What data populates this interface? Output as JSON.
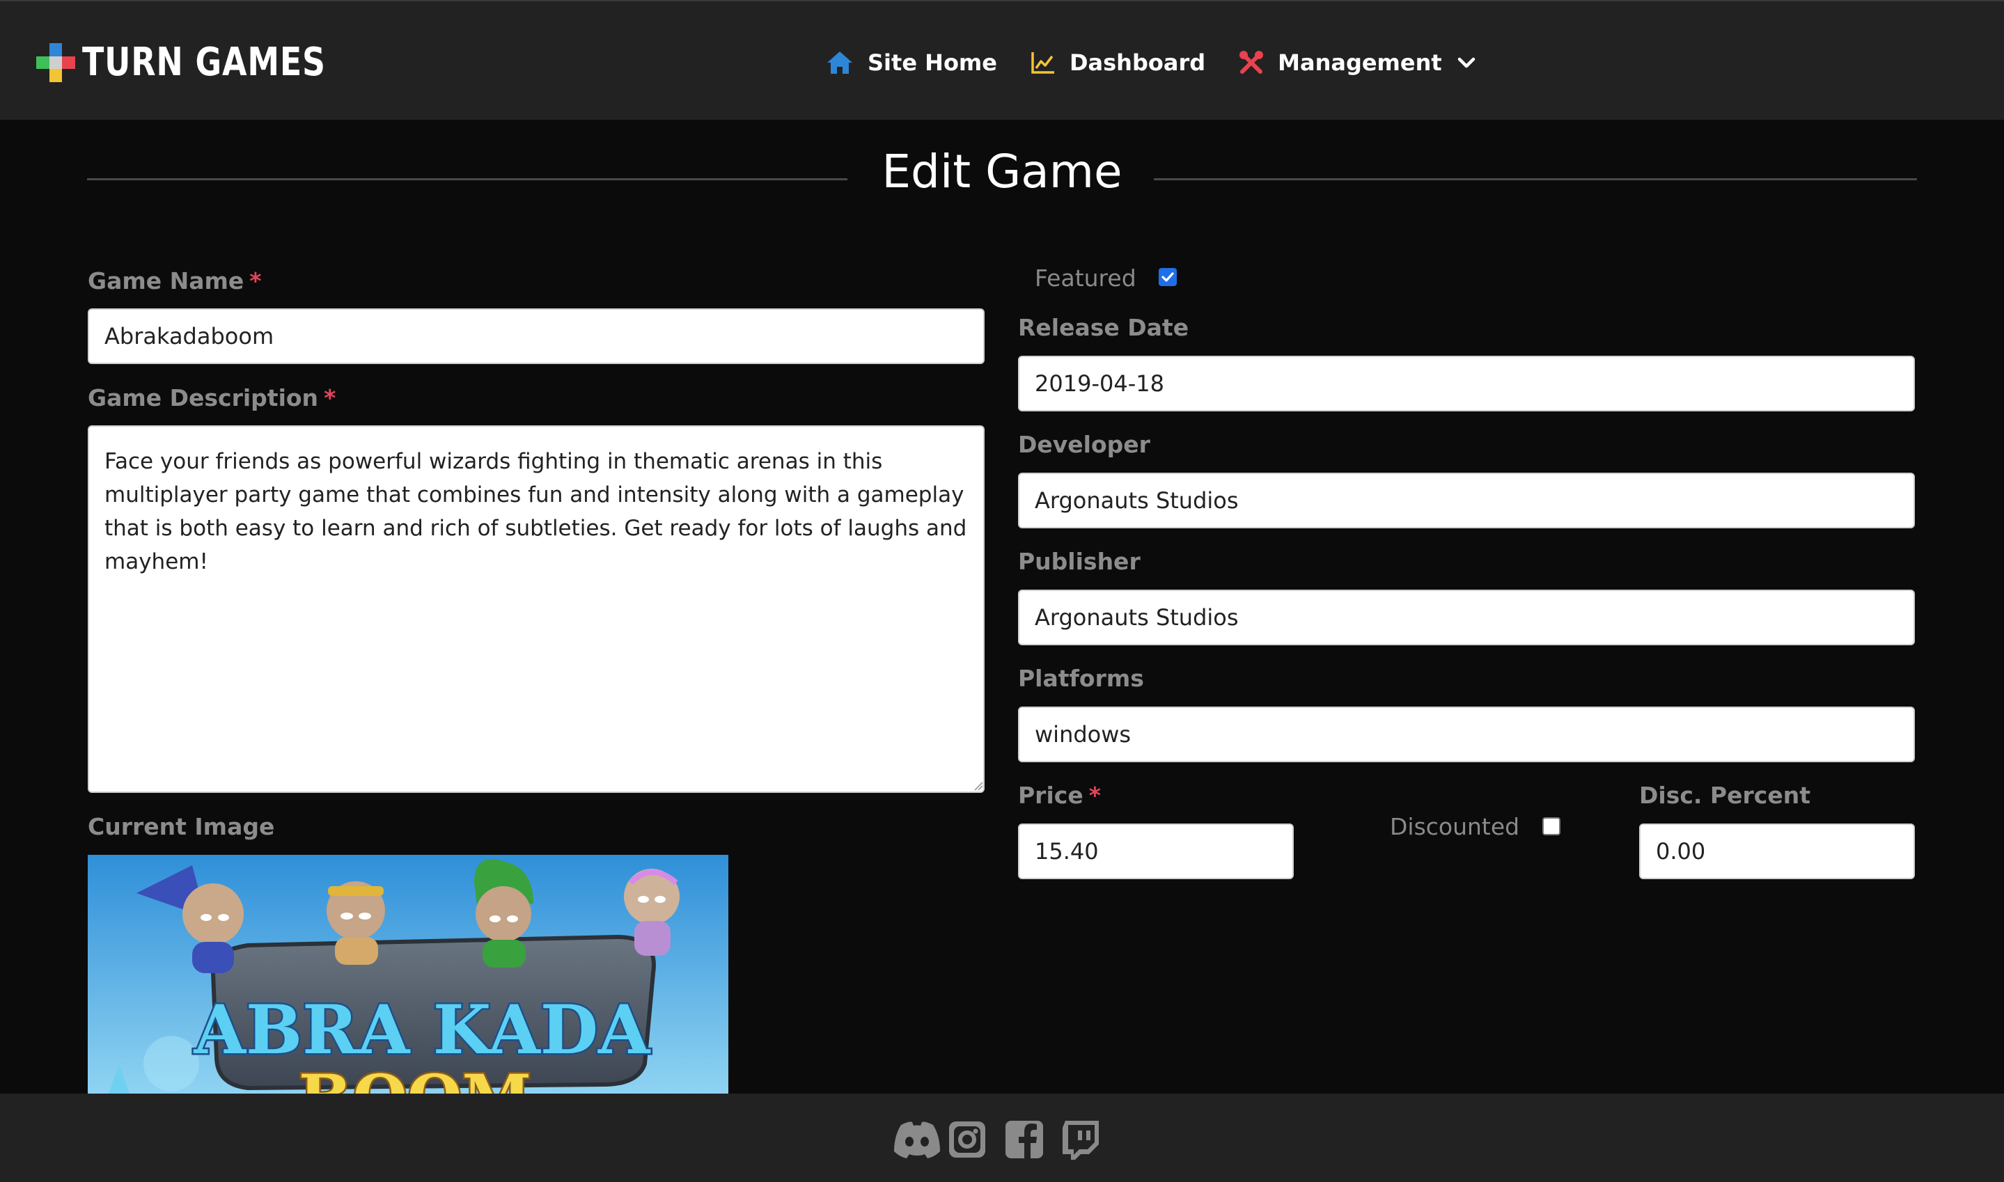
{
  "brand": {
    "name": "TURN GAMES"
  },
  "nav": {
    "items": [
      {
        "label": "Site Home",
        "icon": "home-icon",
        "color": "#2f86d6"
      },
      {
        "label": "Dashboard",
        "icon": "chart-line-icon",
        "color": "#f3c434"
      },
      {
        "label": "Management",
        "icon": "tools-icon",
        "color": "#e8434e",
        "has_dropdown": true
      }
    ]
  },
  "page": {
    "title": "Edit Game"
  },
  "form": {
    "game_name": {
      "label": "Game Name",
      "value": "Abrakadaboom",
      "required": true
    },
    "game_description": {
      "label": "Game Description",
      "value": "Face your friends as powerful wizards fighting in thematic arenas in this multiplayer party game that combines fun and intensity along with a gameplay that is both easy to learn and rich of subtleties. Get ready for lots of laughs and mayhem!",
      "required": true
    },
    "current_image": {
      "label": "Current Image",
      "image_text_line1": "ABRA KADA",
      "image_text_line2": "BOOM"
    },
    "featured": {
      "label": "Featured",
      "checked": true
    },
    "release_date": {
      "label": "Release Date",
      "value": "2019-04-18"
    },
    "developer": {
      "label": "Developer",
      "value": "Argonauts Studios"
    },
    "publisher": {
      "label": "Publisher",
      "value": "Argonauts Studios"
    },
    "platforms": {
      "label": "Platforms",
      "value": "windows"
    },
    "price": {
      "label": "Price",
      "value": "15.40",
      "required": true
    },
    "discounted": {
      "label": "Discounted",
      "checked": false
    },
    "disc_percent": {
      "label": "Disc. Percent",
      "value": "0.00"
    },
    "required_marker": "*"
  },
  "footer": {
    "social": [
      "discord-icon",
      "instagram-icon",
      "facebook-icon",
      "twitch-icon"
    ]
  },
  "colors": {
    "navbar_bg": "#222222",
    "page_bg": "#0b0b0b",
    "label_gray": "#8c8c8c",
    "required_red": "#e2445c",
    "checkbox_blue": "#1f6fe8"
  }
}
